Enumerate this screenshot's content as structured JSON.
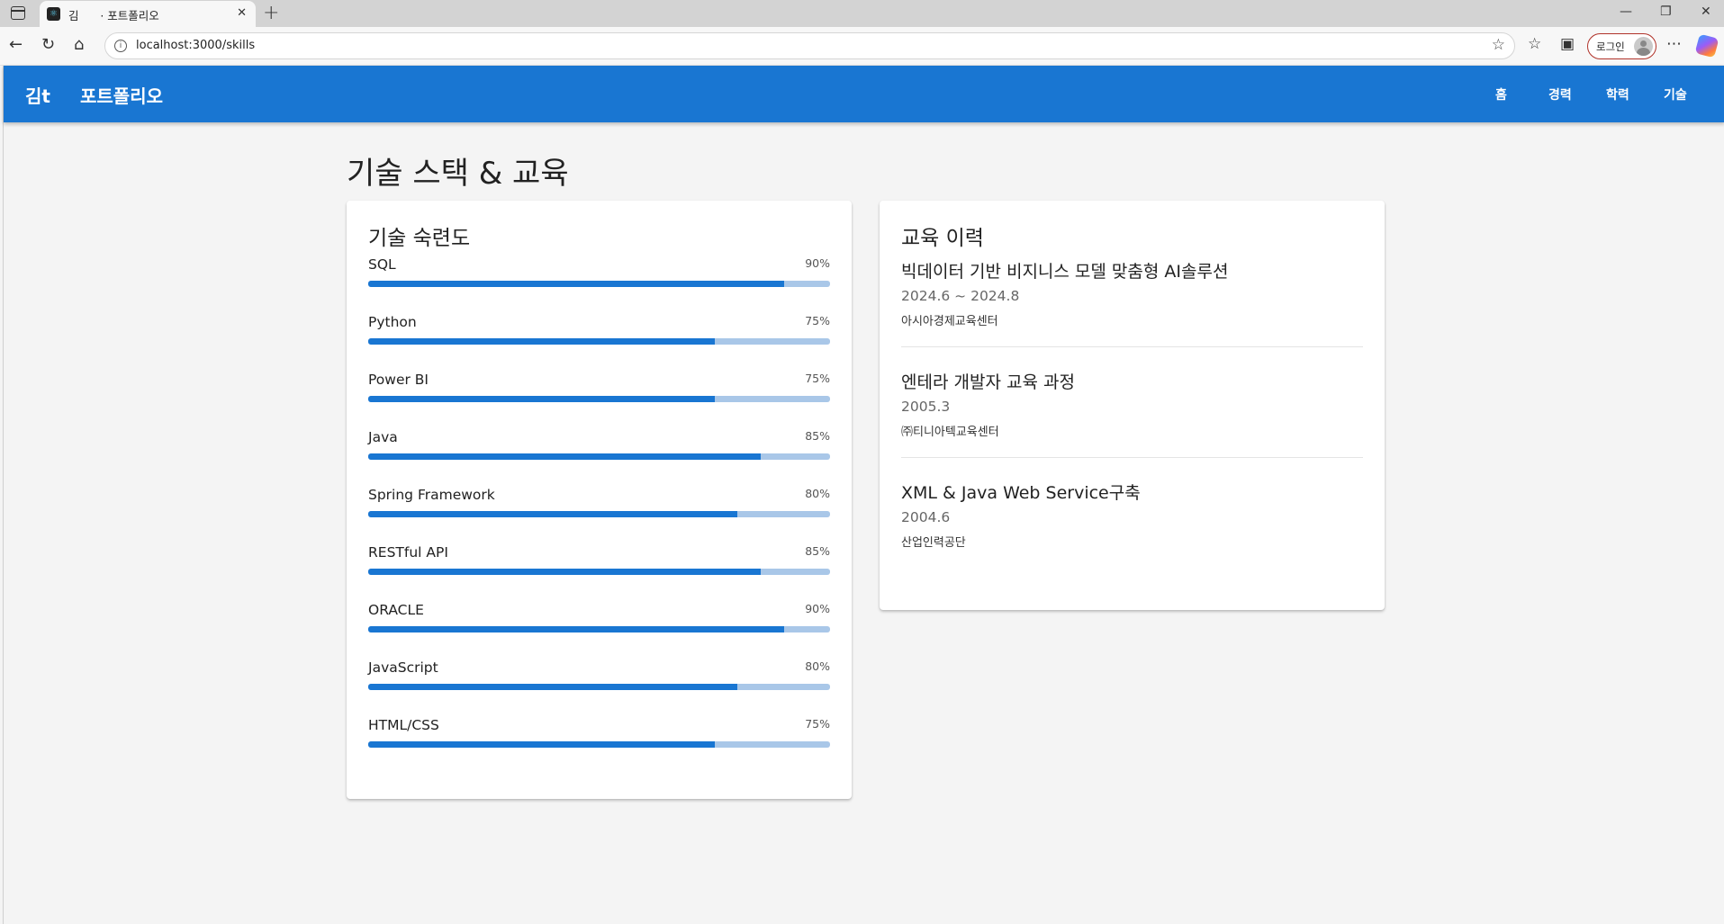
{
  "browser": {
    "tab_title": "김      · 포트폴리오",
    "url": "localhost:3000/skills",
    "login_label": "로그인"
  },
  "app": {
    "logo_text": "김t",
    "brand": "포트폴리오",
    "menu": [
      "홈",
      "경력",
      "학력",
      "기술"
    ],
    "accent_color": "#1976d2"
  },
  "page": {
    "title": "기술 스택 & 교육"
  },
  "skills_card": {
    "title": "기술 숙련도",
    "skills": [
      {
        "name": "SQL",
        "percent_label": "90%",
        "level": 90
      },
      {
        "name": "Python",
        "percent_label": "75%",
        "level": 75
      },
      {
        "name": "Power BI",
        "percent_label": "75%",
        "level": 75
      },
      {
        "name": "Java",
        "percent_label": "85%",
        "level": 85
      },
      {
        "name": "Spring Framework",
        "percent_label": "80%",
        "level": 80
      },
      {
        "name": "RESTful API",
        "percent_label": "85%",
        "level": 85
      },
      {
        "name": "ORACLE",
        "percent_label": "90%",
        "level": 90
      },
      {
        "name": "JavaScript",
        "percent_label": "80%",
        "level": 80
      },
      {
        "name": "HTML/CSS",
        "percent_label": "75%",
        "level": 75
      }
    ]
  },
  "education_card": {
    "title": "교육 이력",
    "items": [
      {
        "title": "빅데이터 기반 비지니스 모델 맞춤형 AI솔루션",
        "period": "2024.6 ~ 2024.8",
        "org": "아시아경제교육센터"
      },
      {
        "title": "엔테라 개발자 교육 과정",
        "period": "2005.3",
        "org": "㈜티니아텍교육센터"
      },
      {
        "title": "XML & Java Web Service구축",
        "period": "2004.6",
        "org": "산업인력공단"
      }
    ]
  }
}
